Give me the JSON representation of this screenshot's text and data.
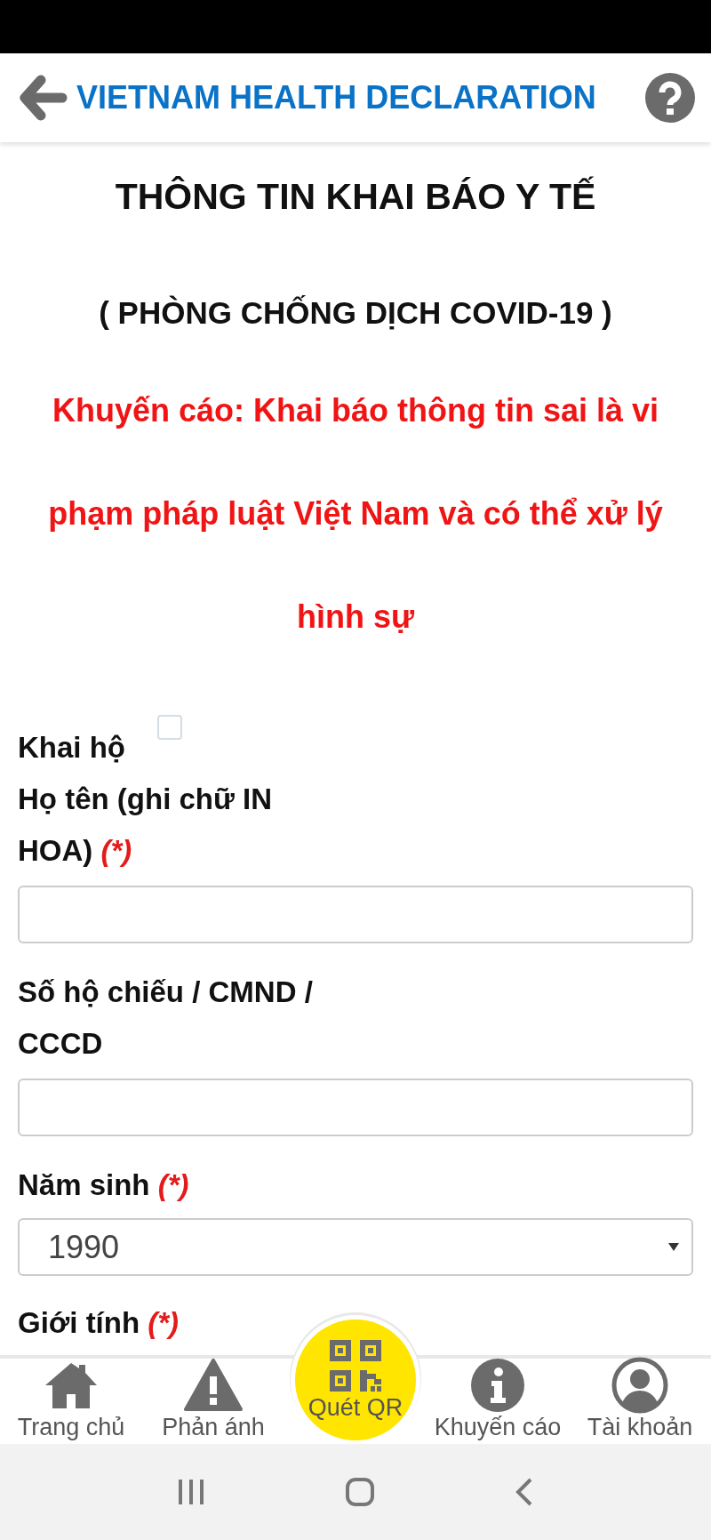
{
  "header": {
    "title": "VIETNAM HEALTH DECLARATION"
  },
  "form": {
    "title": "THÔNG TIN KHAI BÁO Y TẾ",
    "subtitle": "( PHÒNG CHỐNG DỊCH COVID-19 )",
    "warning": "Khuyến cáo: Khai báo thông tin sai là vi phạm pháp luật Việt Nam và có thể xử lý hình sự",
    "fields": [
      {
        "kind": "checkbox",
        "label": "Khai hộ",
        "checked": false
      },
      {
        "kind": "text",
        "label": "Họ tên (ghi chữ IN HOA)",
        "required_mark": "(*)"
      },
      {
        "kind": "text",
        "label": "Số hộ chiếu / CMND / CCCD"
      },
      {
        "kind": "select",
        "label": "Năm sinh",
        "required_mark": "(*)",
        "value": "1990"
      },
      {
        "kind": "heading",
        "label": "Giới tính",
        "required_mark": "(*)"
      }
    ]
  },
  "nav": [
    {
      "kind": "home",
      "label": "Trang chủ"
    },
    {
      "kind": "report",
      "label": "Phản ánh"
    },
    {
      "kind": "qr",
      "label": "Quét QR"
    },
    {
      "kind": "info",
      "label": "Khuyến cáo"
    },
    {
      "kind": "account",
      "label": "Tài khoản"
    }
  ]
}
